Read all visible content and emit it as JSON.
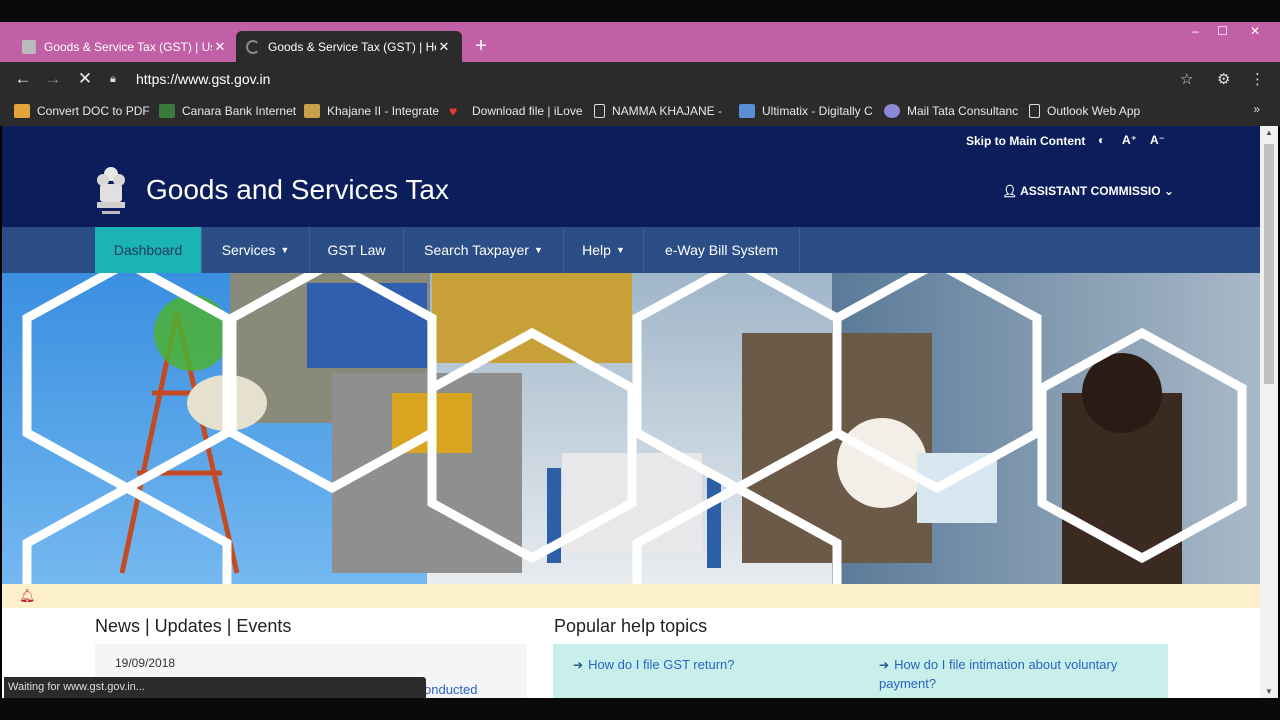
{
  "browser": {
    "tabs": [
      {
        "title": "Goods & Service Tax (GST) | User",
        "active": false
      },
      {
        "title": "Goods & Service Tax (GST) | Hom",
        "active": true
      }
    ],
    "new_tab_symbol": "+",
    "window_controls": {
      "minimize": "–",
      "maximize": "☐",
      "close": "✕"
    },
    "url": "https://www.gst.gov.in",
    "bookmarks": [
      {
        "label": "Convert DOC to PDF",
        "icon": "doc-icon",
        "color": "#e2a33b"
      },
      {
        "label": "Canara Bank Internet",
        "icon": "canara-icon",
        "color": "#3c7a3c"
      },
      {
        "label": "Khajane II - Integrate",
        "icon": "khajane-icon",
        "color": "#c9a04a"
      },
      {
        "label": "Download file | iLove",
        "icon": "heart-icon",
        "color": "#e23a3a"
      },
      {
        "label": "NAMMA KHAJANE -",
        "icon": "page-icon",
        "color": "#dddddd"
      },
      {
        "label": "Ultimatix - Digitally C",
        "icon": "ultimatix-icon",
        "color": "#5b8ed6"
      },
      {
        "label": "Mail Tata Consultanc",
        "icon": "mail-icon",
        "color": "#8a8ad6"
      },
      {
        "label": "Outlook Web App",
        "icon": "page-icon",
        "color": "#dddddd"
      }
    ],
    "bookmarks_more": "»",
    "status_text": "Waiting for www.gst.gov.in..."
  },
  "site": {
    "skip_link": "Skip to Main Content",
    "font_increase": "A⁺",
    "font_decrease": "A⁻",
    "title": "Goods and Services Tax",
    "user_label": "ASSISTANT COMMISSIO",
    "nav": [
      {
        "label": "Dashboard",
        "active": true,
        "dropdown": false
      },
      {
        "label": "Services",
        "active": false,
        "dropdown": true
      },
      {
        "label": "GST Law",
        "active": false,
        "dropdown": false
      },
      {
        "label": "Search Taxpayer",
        "active": false,
        "dropdown": true
      },
      {
        "label": "Help",
        "active": false,
        "dropdown": true
      },
      {
        "label": "e-Way Bill System",
        "active": false,
        "dropdown": false
      }
    ],
    "news_title": "News | Updates | Events",
    "news_date": "19/09/2018",
    "news_link_fragment": "onducted",
    "help_title": "Popular help topics",
    "help_links": [
      {
        "text": "How do I file GST return?"
      },
      {
        "text": "How do I file intimation about voluntary"
      },
      {
        "text": "payment?"
      }
    ]
  },
  "colors": {
    "tabstrip": "#c160a6",
    "header": "#0b1e5b",
    "nav": "#2c4e86",
    "nav_active": "#1bb3b3",
    "alert_bar": "#fbefcc",
    "help_box": "#c8efe9"
  }
}
